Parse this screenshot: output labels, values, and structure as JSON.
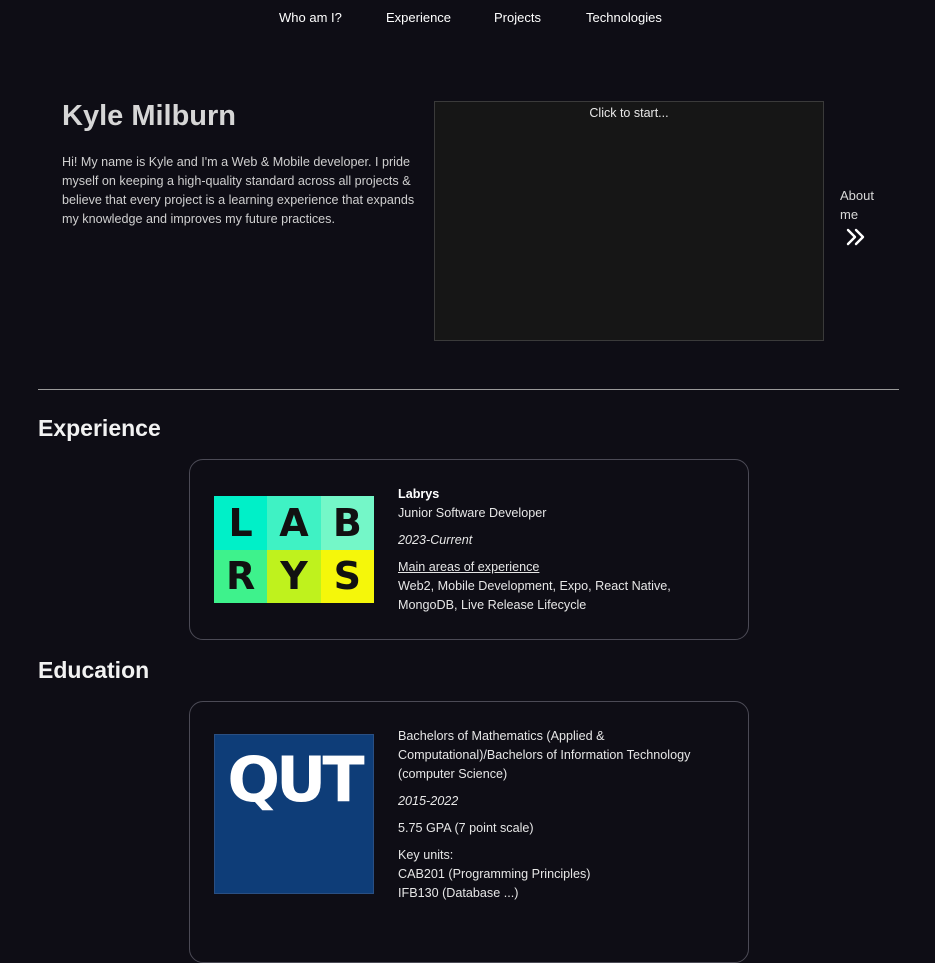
{
  "nav": {
    "items": [
      {
        "label": "Who am I?"
      },
      {
        "label": "Experience"
      },
      {
        "label": "Projects"
      },
      {
        "label": "Technologies"
      }
    ]
  },
  "hero": {
    "name": "Kyle Milburn",
    "description": "Hi! My name is Kyle and I'm a Web & Mobile developer. I pride myself on keeping a high-quality standard across all projects & believe that every project is a learning experience that expands my knowledge and improves my future practices.",
    "game_hint": "Click to start...",
    "about_label": "About me",
    "about_icon": "double-chevron-right-icon"
  },
  "experience": {
    "title": "Experience",
    "cards": [
      {
        "logo": {
          "icon": "labrys-logo",
          "letters": [
            "L",
            "A",
            "B",
            "R",
            "Y",
            "S"
          ],
          "colors": [
            "#00f0c8",
            "#3ff2c4",
            "#74f7c8",
            "#3ef28c",
            "#bff21d",
            "#f5f70a"
          ]
        },
        "company": "Labrys",
        "role": "Junior Software Developer",
        "dates": "2023-Current",
        "areas_label": "Main areas of experience",
        "areas": "Web2, Mobile Development, Expo, React Native, MongoDB, Live Release Lifecycle"
      }
    ]
  },
  "education": {
    "title": "Education",
    "cards": [
      {
        "logo": {
          "icon": "qut-logo",
          "text": "QUT",
          "color": "#0e3d78"
        },
        "degree": "Bachelors of Mathematics (Applied & Computational)/Bachelors of Information Technology (computer Science)",
        "dates": "2015-2022",
        "gpa": "5.75 GPA (7 point scale)",
        "units_label": "Key units:",
        "units": [
          "CAB201 (Programming Principles)",
          "IFB130 (Database ...)"
        ]
      }
    ]
  }
}
